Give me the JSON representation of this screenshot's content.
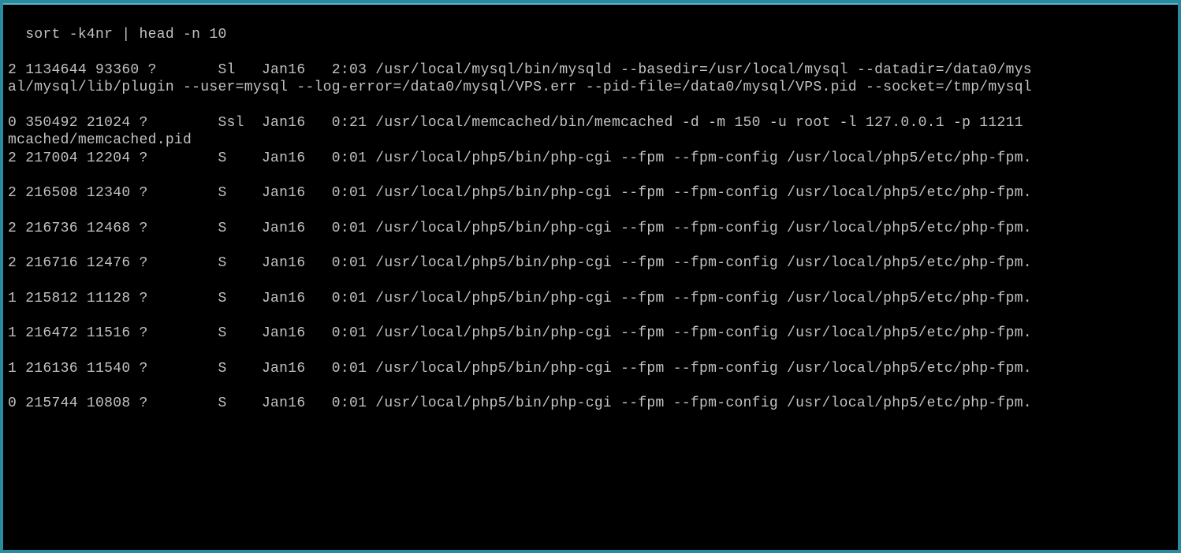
{
  "terminal": {
    "command": "sort -k4nr | head -n 10",
    "lines": [
      "2 1134644 93360 ?       Sl   Jan16   2:03 /usr/local/mysql/bin/mysqld --basedir=/usr/local/mysql --datadir=/data0/mys",
      "al/mysql/lib/plugin --user=mysql --log-error=/data0/mysql/VPS.err --pid-file=/data0/mysql/VPS.pid --socket=/tmp/mysql",
      "",
      "0 350492 21024 ?        Ssl  Jan16   0:21 /usr/local/memcached/bin/memcached -d -m 150 -u root -l 127.0.0.1 -p 11211 ",
      "mcached/memcached.pid",
      "2 217004 12204 ?        S    Jan16   0:01 /usr/local/php5/bin/php-cgi --fpm --fpm-config /usr/local/php5/etc/php-fpm.",
      "",
      "2 216508 12340 ?        S    Jan16   0:01 /usr/local/php5/bin/php-cgi --fpm --fpm-config /usr/local/php5/etc/php-fpm.",
      "",
      "2 216736 12468 ?        S    Jan16   0:01 /usr/local/php5/bin/php-cgi --fpm --fpm-config /usr/local/php5/etc/php-fpm.",
      "",
      "2 216716 12476 ?        S    Jan16   0:01 /usr/local/php5/bin/php-cgi --fpm --fpm-config /usr/local/php5/etc/php-fpm.",
      "",
      "1 215812 11128 ?        S    Jan16   0:01 /usr/local/php5/bin/php-cgi --fpm --fpm-config /usr/local/php5/etc/php-fpm.",
      "",
      "1 216472 11516 ?        S    Jan16   0:01 /usr/local/php5/bin/php-cgi --fpm --fpm-config /usr/local/php5/etc/php-fpm.",
      "",
      "1 216136 11540 ?        S    Jan16   0:01 /usr/local/php5/bin/php-cgi --fpm --fpm-config /usr/local/php5/etc/php-fpm.",
      "",
      "0 215744 10808 ?        S    Jan16   0:01 /usr/local/php5/bin/php-cgi --fpm --fpm-config /usr/local/php5/etc/php-fpm."
    ]
  }
}
